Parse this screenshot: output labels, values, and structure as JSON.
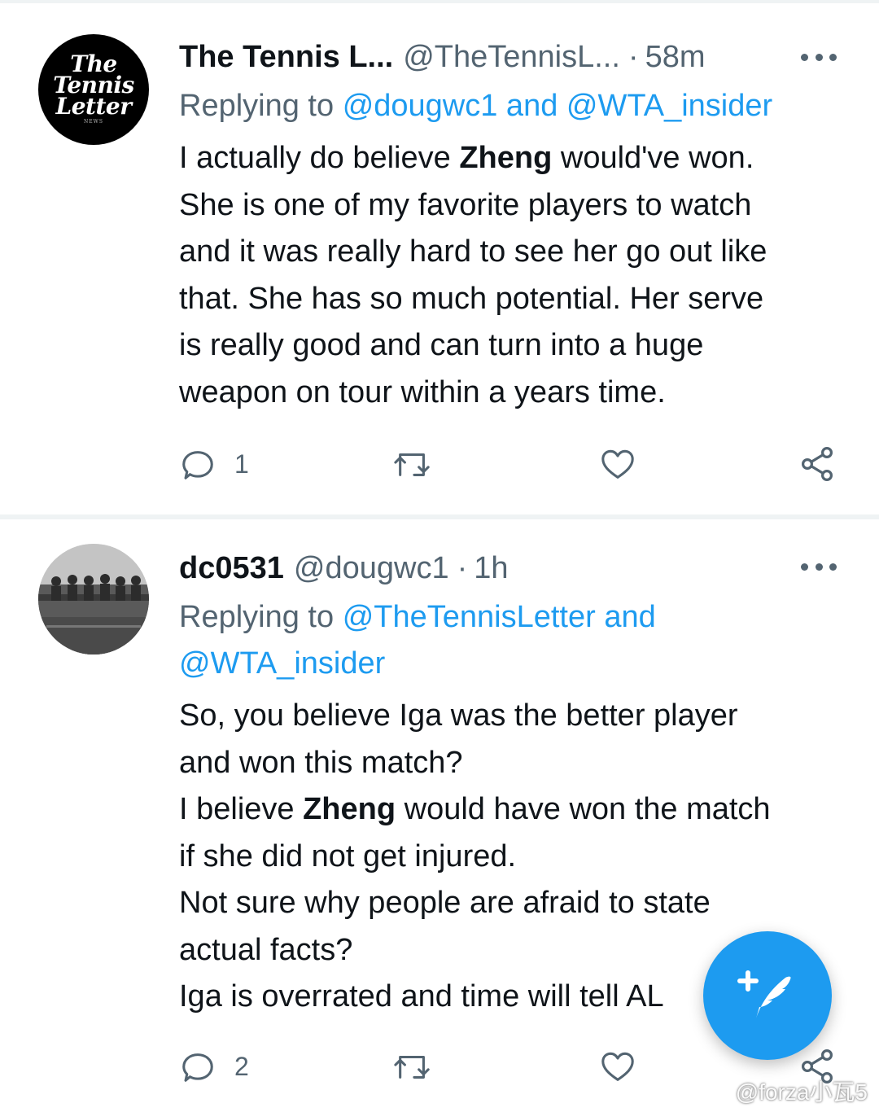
{
  "tweets": [
    {
      "avatar_logo": "The Tennis Letter",
      "name": "The Tennis L...",
      "handle": "@TheTennisL...",
      "dot": "·",
      "time": "58m",
      "replying_prefix": "Replying to",
      "mentions_line1": "@dougwc1 and @WTA_insider",
      "body": [
        [
          "I actually do believe ",
          "Zheng",
          " would've won."
        ],
        [
          "She is one of my favorite players to watch",
          "",
          ""
        ],
        [
          "and it was really hard to see her go out like",
          "",
          ""
        ],
        [
          "that. She has so much potential. Her serve",
          "",
          ""
        ],
        [
          "is really good and can turn into a huge",
          "",
          ""
        ],
        [
          "weapon on tour within a years time.",
          "",
          ""
        ]
      ],
      "reply_count": "1",
      "icons": [
        "reply-icon",
        "retweet-icon",
        "like-icon",
        "share-icon",
        "more-icon"
      ]
    },
    {
      "name": "dc0531",
      "handle": "@dougwc1",
      "dot": "·",
      "time": "1h",
      "replying_prefix": "Replying to",
      "mentions_line1": "@TheTennisLetter and",
      "mentions_line2": "@WTA_insider",
      "body": [
        [
          "So, you believe Iga was the better player",
          "",
          ""
        ],
        [
          "and won this match?",
          "",
          ""
        ],
        [
          "I believe ",
          "Zheng",
          " would have won the match"
        ],
        [
          "if she did not get injured.",
          "",
          ""
        ],
        [
          "Not sure why people are afraid to state",
          "",
          ""
        ],
        [
          "actual facts?",
          "",
          ""
        ],
        [
          "Iga is overrated and time will tell AL",
          "",
          ""
        ]
      ],
      "reply_count": "2",
      "icons": [
        "reply-icon",
        "retweet-icon",
        "like-icon",
        "share-icon",
        "more-icon"
      ]
    }
  ],
  "fab": {
    "icon": "compose-tweet-icon"
  },
  "watermark": "@forza小瓦5",
  "colors": {
    "accent": "#1d9bf0",
    "text": "#0f1419",
    "secondary": "#536471",
    "divider": "#eff3f4"
  }
}
